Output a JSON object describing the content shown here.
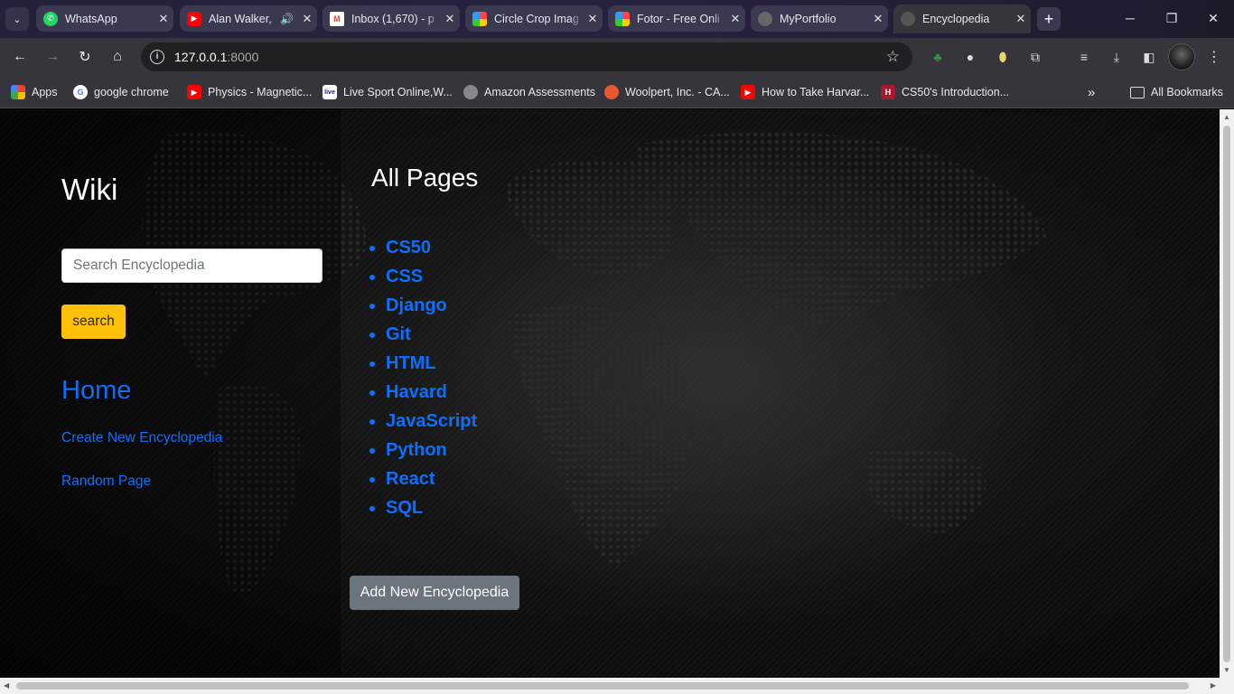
{
  "browser": {
    "tabs": [
      {
        "title": "WhatsApp",
        "icon": "whatsapp-icon",
        "color": "#25d366"
      },
      {
        "title": "Alan Walker,",
        "icon": "youtube-icon",
        "color": "#ff0000",
        "audio": "speaker-icon"
      },
      {
        "title": "Inbox (1,670) - p",
        "icon": "gmail-icon",
        "color": "#ea4335"
      },
      {
        "title": "Circle Crop Imag",
        "icon": "circle-crop-icon",
        "color": "#f7b500"
      },
      {
        "title": "Fotor - Free Onli",
        "icon": "fotor-icon",
        "color": "#f7b500"
      },
      {
        "title": "MyPortfolio",
        "icon": "globe-icon",
        "color": "#777777"
      },
      {
        "title": "Encyclopedia",
        "icon": "globe-icon",
        "color": "#777777"
      }
    ],
    "address": {
      "host": "127.0.0.1",
      "port": ":8000"
    },
    "bookmarks": [
      {
        "label": "Apps",
        "icon": "apps-grid-icon"
      },
      {
        "label": "google chrome",
        "icon": "google-icon"
      },
      {
        "label": "Physics - Magnetic...",
        "icon": "youtube-icon"
      },
      {
        "label": "Live Sport Online,W...",
        "icon": "live-icon"
      },
      {
        "label": "Amazon Assessments",
        "icon": "globe-icon"
      },
      {
        "label": "Woolpert, Inc. - CA...",
        "icon": "woolpert-icon"
      },
      {
        "label": "How to Take Harvar...",
        "icon": "youtube-icon"
      },
      {
        "label": "CS50's Introduction...",
        "icon": "harvard-icon"
      }
    ],
    "bookmarks_overflow": "»",
    "all_bookmarks": "All Bookmarks"
  },
  "sidebar": {
    "title": "Wiki",
    "search_placeholder": "Search Encyclopedia",
    "search_button": "search",
    "home_link": "Home",
    "create_link": "Create New Encyclopedia",
    "random_link": "Random Page"
  },
  "main": {
    "heading": "All Pages",
    "entries": [
      "CS50",
      "CSS",
      "Django",
      "Git",
      "HTML",
      "Havard",
      "JavaScript",
      "Python",
      "React",
      "SQL"
    ],
    "add_button": "Add New Encyclopedia"
  },
  "colors": {
    "link": "#0d6efd",
    "search_button": "#ffc107",
    "add_button": "#6c757d"
  }
}
